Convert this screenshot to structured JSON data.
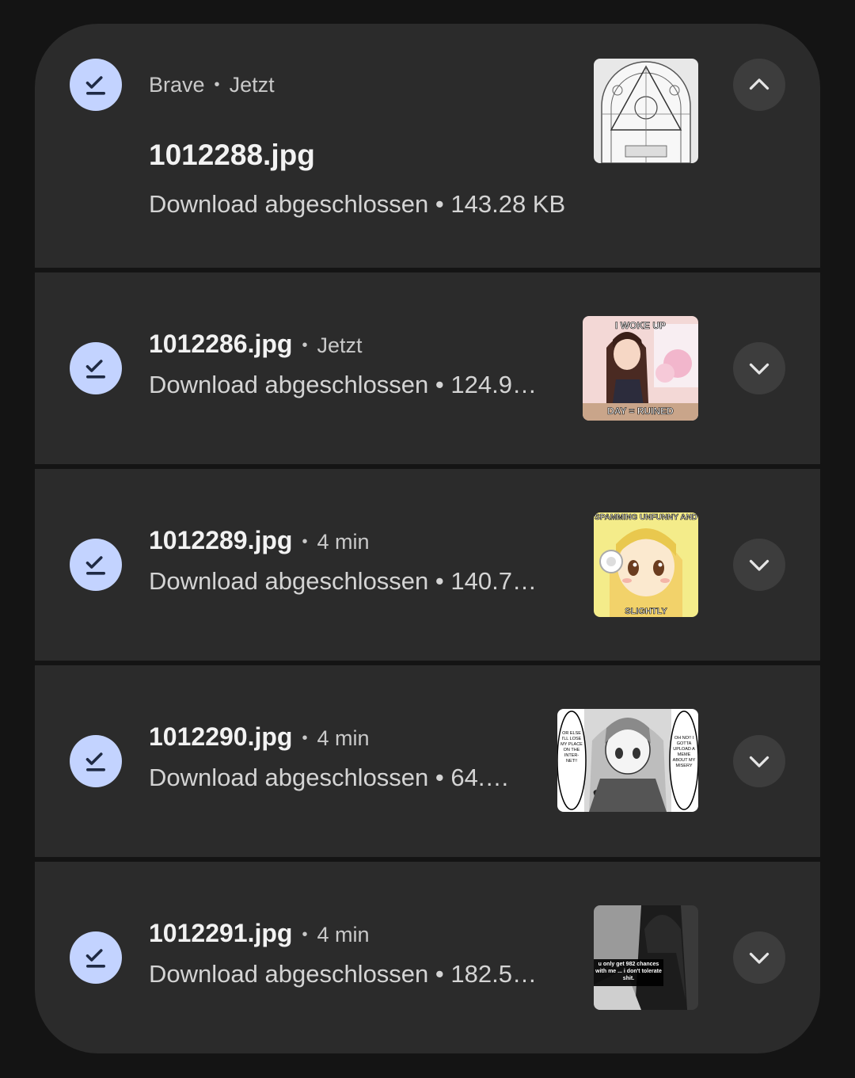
{
  "colors": {
    "background": "#141414",
    "card": "#2b2b2b",
    "icon_circle": "#c3d3ff",
    "button_circle": "#3d3d3d"
  },
  "expanded": {
    "app": "Brave",
    "time": "Jetzt",
    "filename": "1012288.jpg",
    "status": "Download abgeschlossen • 143.28 KB",
    "thumb_icon": "chart-meme-thumbnail",
    "button_icon": "chevron-up-icon"
  },
  "items": [
    {
      "filename": "1012286.jpg",
      "time": "Jetzt",
      "status": "Download abgeschlossen • 124.9…",
      "thumb_text_top": "I WOKE UP",
      "thumb_text_bottom": "DAY = RUINED"
    },
    {
      "filename": "1012289.jpg",
      "time": "4 min",
      "status": "Download abgeschlossen • 140.7…",
      "thumb_text_top": "SPAMMING UNFUNNY AND",
      "thumb_text_bottom": "SLIGHTLY"
    },
    {
      "filename": "1012290.jpg",
      "time": "4 min",
      "status": "Download abgeschlossen • 64.…",
      "thumb_text_left": "OR ELSE I'LL LOSE MY PLACE ON THE INTER-NET!!",
      "thumb_text_right": "OH NO!! I GOTTA UPLOAD A MEME ABOUT MY MISERY"
    },
    {
      "filename": "1012291.jpg",
      "time": "4 min",
      "status": "Download abgeschlossen • 182.5…",
      "thumb_text_top": "u only get 982 chances with me ... i don't tolerate shit."
    }
  ]
}
